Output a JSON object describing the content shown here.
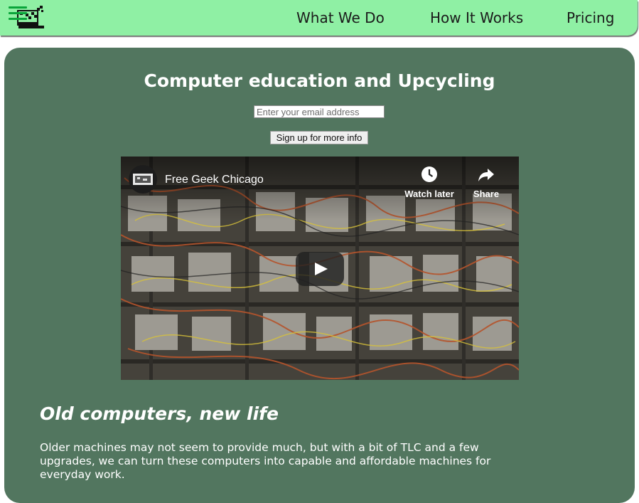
{
  "navbar": {
    "logo_icon": "computer-recycle-logo-icon",
    "menu_icon": "hamburger-menu-icon",
    "links": [
      {
        "label": "What We Do"
      },
      {
        "label": "How It Works"
      },
      {
        "label": "Pricing"
      }
    ]
  },
  "hero": {
    "title": "Computer education and Upcycling",
    "email_placeholder": "Enter your email address",
    "email_value": "",
    "signup_label": "Sign up for more info"
  },
  "video": {
    "title": "Free Geek Chicago",
    "watch_later_label": "Watch later",
    "share_label": "Share",
    "icons": [
      "clock-icon",
      "share-arrow-icon",
      "play-icon"
    ]
  },
  "section": {
    "title": "Old computers, new life",
    "body": "Older machines may not seem to provide much, but with a bit of TLC and a few upgrades, we can turn these computers into capable and affordable machines for everyday work."
  },
  "colors": {
    "navbar": "#8ff0a4",
    "panel": "#52765f",
    "menu_icon": "#0aa53a",
    "text_light": "#ffffff"
  }
}
